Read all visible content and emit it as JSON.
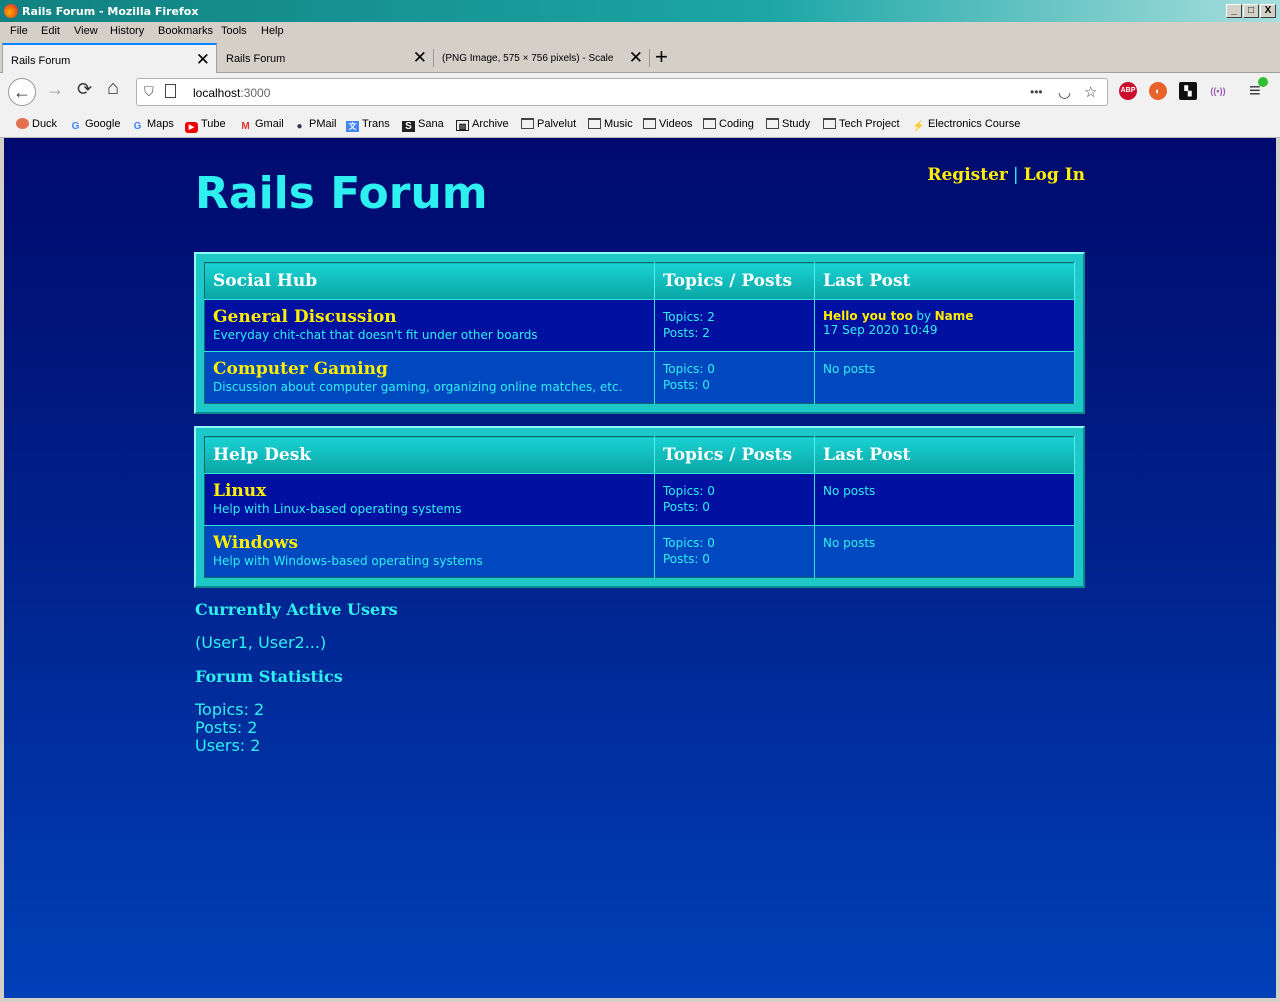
{
  "window": {
    "title": "Rails Forum - Mozilla Firefox",
    "min": "_",
    "max": "□",
    "close": "X"
  },
  "menu": [
    "File",
    "Edit",
    "View",
    "History",
    "Bookmarks",
    "Tools",
    "Help"
  ],
  "tabs": [
    {
      "label": "Rails Forum",
      "active": true
    },
    {
      "label": "Rails Forum",
      "active": false
    },
    {
      "label": "(PNG Image, 575 × 756 pixels) - Scale",
      "active": false
    }
  ],
  "new_tab": "+",
  "nav": {
    "back": "←",
    "forward": "→",
    "reload": "⟳",
    "home": "⌂",
    "url_host": "localhost",
    "url_port": ":3000",
    "more": "•••",
    "menu": "≡"
  },
  "extensions": [
    "ABP"
  ],
  "bookmarks": [
    "Duck",
    "Google",
    "Maps",
    "Tube",
    "Gmail",
    "PMail",
    "Trans",
    "Sana",
    "Archive",
    "Palvelut",
    "Music",
    "Videos",
    "Coding",
    "Study",
    "Tech Project",
    "Electronics Course"
  ],
  "site": {
    "title": "Rails Forum",
    "register": "Register",
    "separator": "|",
    "login": "Log In"
  },
  "boards": [
    {
      "name": "Social Hub",
      "col_stats": "Topics / Posts",
      "col_last": "Last Post",
      "forums": [
        {
          "name": "General Discussion",
          "description": "Everyday chit-chat that doesn't fit under other boards",
          "topics": "Topics: 2",
          "posts": "Posts: 2",
          "last_title": "Hello you too",
          "last_by": "by",
          "last_user": "Name",
          "last_date": "17 Sep 2020 10:49"
        },
        {
          "name": "Computer Gaming",
          "description": "Discussion about computer gaming, organizing online matches, etc.",
          "topics": "Topics: 0",
          "posts": "Posts: 0",
          "last_none": "No posts"
        }
      ]
    },
    {
      "name": "Help Desk",
      "col_stats": "Topics / Posts",
      "col_last": "Last Post",
      "forums": [
        {
          "name": "Linux",
          "description": "Help with Linux-based operating systems",
          "topics": "Topics: 0",
          "posts": "Posts: 0",
          "last_none": "No posts"
        },
        {
          "name": "Windows",
          "description": "Help with Windows-based operating systems",
          "topics": "Topics: 0",
          "posts": "Posts: 0",
          "last_none": "No posts"
        }
      ]
    }
  ],
  "active_users": {
    "heading": "Currently Active Users",
    "list": "(User1, User2...)"
  },
  "statistics": {
    "heading": "Forum Statistics",
    "topics": "Topics: 2",
    "posts": "Posts: 2",
    "users": "Users: 2"
  }
}
